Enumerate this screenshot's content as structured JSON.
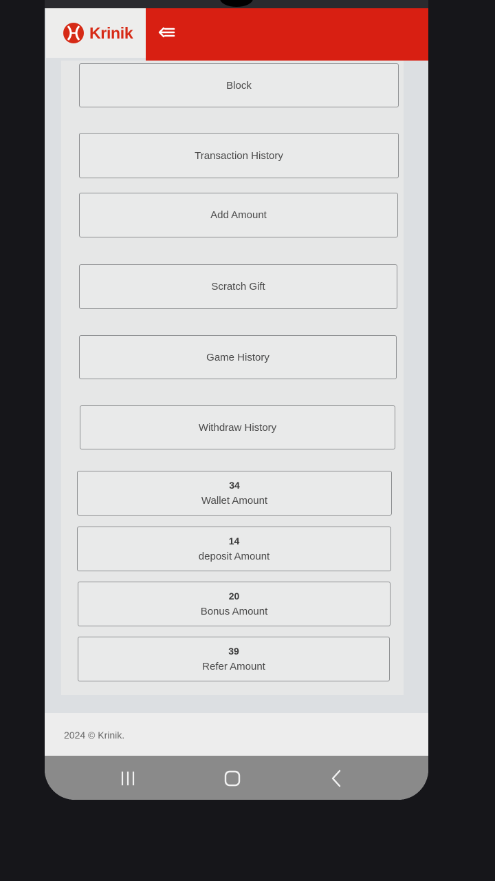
{
  "brand": {
    "name": "Krinik",
    "accent_color": "#d81f12"
  },
  "header": {
    "menu_icon": "menu-collapse-icon"
  },
  "menu": [
    {
      "id": "block",
      "label": "Block"
    },
    {
      "id": "transaction-history",
      "label": "Transaction History"
    },
    {
      "id": "add-amount",
      "label": "Add Amount"
    },
    {
      "id": "scratch-gift",
      "label": "Scratch Gift"
    },
    {
      "id": "game-history",
      "label": "Game History"
    },
    {
      "id": "withdraw-history",
      "label": "Withdraw History"
    }
  ],
  "stats": [
    {
      "id": "wallet",
      "value": "34",
      "label": "Wallet Amount"
    },
    {
      "id": "deposit",
      "value": "14",
      "label": "deposit Amount"
    },
    {
      "id": "bonus",
      "value": "20",
      "label": "Bonus Amount"
    },
    {
      "id": "refer",
      "value": "39",
      "label": "Refer Amount"
    }
  ],
  "footer": {
    "copyright": "2024 © Krinik."
  },
  "system_nav": {
    "recents_icon": "recents-icon",
    "home_icon": "home-icon",
    "back_icon": "back-icon"
  }
}
